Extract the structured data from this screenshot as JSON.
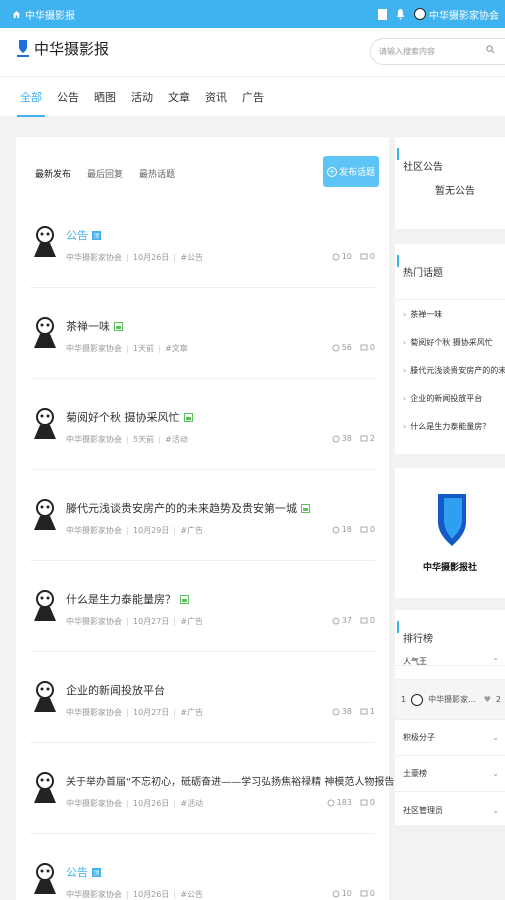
{
  "topbar": {
    "home_label": "中华摄影报",
    "user_label": "中华摄影家协会"
  },
  "header": {
    "logo_title": "中华摄影报",
    "search_placeholder": "请输入搜索内容"
  },
  "nav": {
    "tabs": [
      {
        "label": "全部",
        "active": true
      },
      {
        "label": "公告"
      },
      {
        "label": "晒图"
      },
      {
        "label": "活动"
      },
      {
        "label": "文章"
      },
      {
        "label": "资讯"
      },
      {
        "label": "广告"
      }
    ]
  },
  "main": {
    "subtabs": [
      {
        "label": "最新发布",
        "active": true
      },
      {
        "label": "最后回复"
      },
      {
        "label": "最热话题"
      }
    ],
    "post_button": "发布话题",
    "posts": [
      {
        "title": "公告",
        "tag": "pin",
        "author": "中华摄影家协会",
        "date": "10月26日",
        "category": "#公告",
        "views": "10",
        "comments": "0",
        "blue": true
      },
      {
        "title": "茶禅一味",
        "tag": "img",
        "author": "中华摄影家协会",
        "date": "1天前",
        "category": "#文章",
        "views": "56",
        "comments": "0"
      },
      {
        "title": "菊阅好个秋 摄协采风忙",
        "tag": "img",
        "author": "中华摄影家协会",
        "date": "5天前",
        "category": "#活动",
        "views": "38",
        "comments": "2"
      },
      {
        "title": "滕代元浅谈贵安房产的的未来趋势及贵安第一城",
        "tag": "img",
        "author": "中华摄影家协会",
        "date": "10月29日",
        "category": "#广告",
        "views": "18",
        "comments": "0"
      },
      {
        "title": "什么是生力泰能量房？",
        "tag": "img",
        "author": "中华摄影家协会",
        "date": "10月27日",
        "category": "#广告",
        "views": "37",
        "comments": "0"
      },
      {
        "title": "企业的新闻投放平台",
        "tag": "",
        "author": "中华摄影家协会",
        "date": "10月27日",
        "category": "#广告",
        "views": "38",
        "comments": "1"
      },
      {
        "title": "关于举办首届“不忘初心，砥砺奋进——学习弘扬焦裕禄精 神模范人物报告会”邀请函",
        "tag": "",
        "author": "中华摄影家协会",
        "date": "10月26日",
        "category": "#活动",
        "views": "183",
        "comments": "0"
      },
      {
        "title": "公告",
        "tag": "pin",
        "author": "中华摄影家协会",
        "date": "10月26日",
        "category": "#公告",
        "views": "10",
        "comments": "0",
        "blue": true
      }
    ]
  },
  "sidebar": {
    "notice_title": "社区公告",
    "notice_text": "暂无公告",
    "hot_title": "热门话题",
    "hot_topics": [
      "茶禅一味",
      "菊阅好个秋 摄协采风忙",
      "滕代元浅谈贵安房产的的未...",
      "企业的新闻投放平台",
      "什么是生力泰能量房？"
    ],
    "ad_caption": "中华摄影报社",
    "rank_title": "排行榜",
    "rank_groups": [
      "人气王",
      "积极分子",
      "土豪榜",
      "社区管理员"
    ],
    "rank_user": {
      "index": "1",
      "name": "中华摄影家...",
      "count": "2"
    }
  },
  "colors": {
    "accent": "#3fb2f0",
    "button": "#5ec4f6"
  }
}
